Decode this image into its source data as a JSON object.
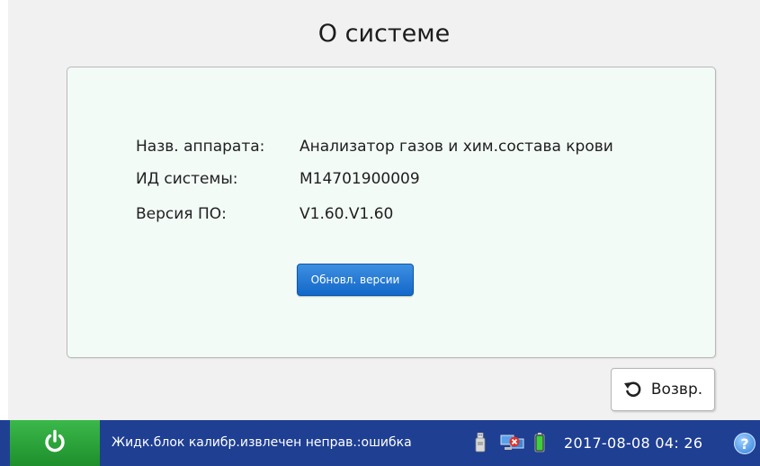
{
  "page": {
    "title": "О системе"
  },
  "info": {
    "device_name_label": "Назв. аппарата:",
    "device_name_value": "Анализатор газов и хим.состава крови",
    "system_id_label": "ИД системы:",
    "system_id_value": "M14701900009",
    "software_version_label": "Версия ПО:",
    "software_version_value": "V1.60.V1.60"
  },
  "buttons": {
    "update_version": "Обновл. версии",
    "back": "Возвр."
  },
  "statusbar": {
    "message": "Жидк.блок калибр.извлечен неправ.:ошибка",
    "datetime": "2017-08-08  04: 26",
    "help_symbol": "?"
  },
  "icons": {
    "power": "power-icon",
    "usb": "usb-icon",
    "network": "network-error-icon",
    "battery": "battery-icon",
    "back": "undo-arrow-icon",
    "help": "help-icon"
  },
  "colors": {
    "statusbar_bg": "#1f3f93",
    "power_button": "#2ea53c",
    "update_button": "#1a72d0",
    "panel_bg": "#f3fbf7"
  }
}
